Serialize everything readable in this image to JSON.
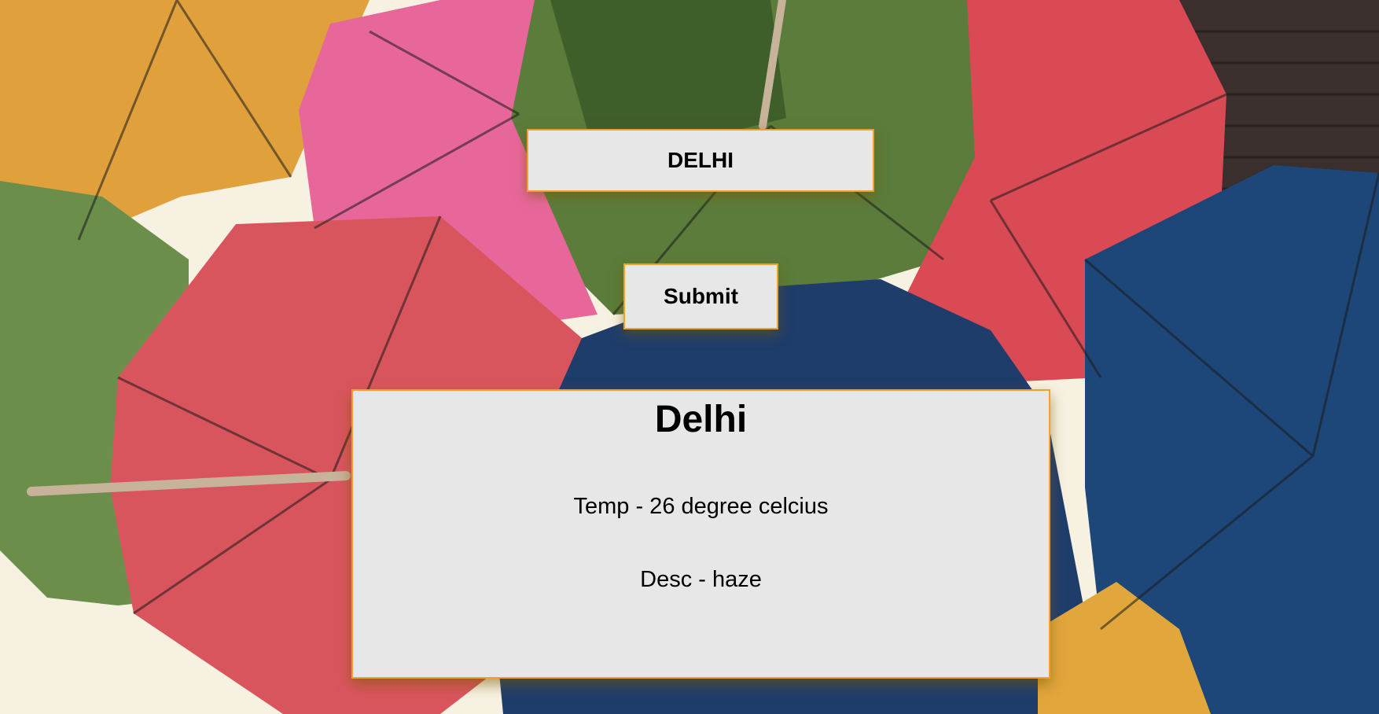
{
  "search": {
    "value": "DELHI"
  },
  "submit": {
    "label": "Submit"
  },
  "result": {
    "city": "Delhi",
    "temp_text": "Temp - 26 degree celcius",
    "desc_text": "Desc - haze"
  },
  "colors": {
    "panel_bg": "#e7e7e7",
    "panel_border": "#f0a030"
  }
}
